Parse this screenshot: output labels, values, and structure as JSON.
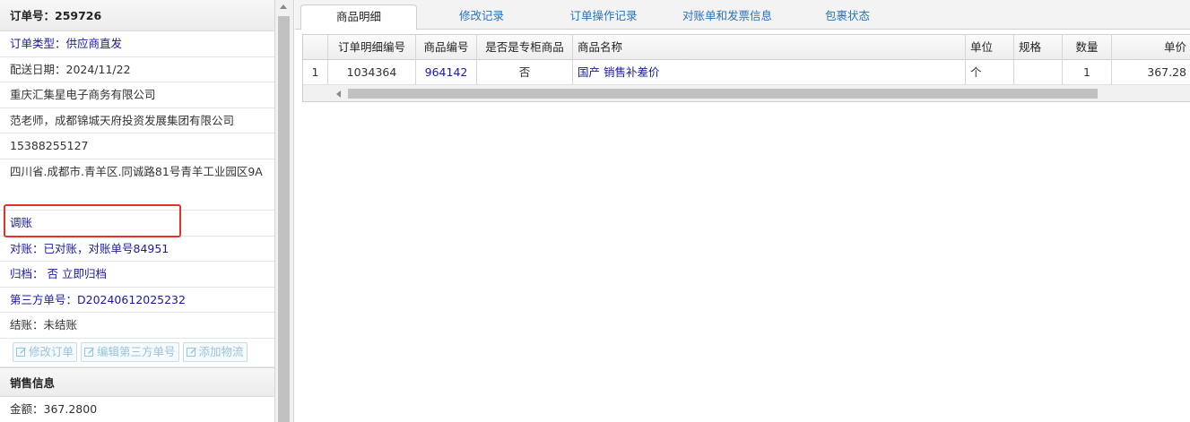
{
  "order": {
    "header": "订单号：259726",
    "type": "订单类型：供应商直发",
    "delivery_date": "配送日期：2024/11/22",
    "company": "重庆汇集星电子商务有限公司",
    "contact": "范老师，成都锦城天府投资发展集团有限公司",
    "phone": "15388255127",
    "address": "四川省.成都市.青羊区.同诚路81号青羊工业园区9A",
    "adjust": "调账",
    "reconcile": "对账：已对账，对账单号84951",
    "archive": "归档： 否 立即归档",
    "third_party": "第三方单号：D20240612025232",
    "settlement": "结账：未结账"
  },
  "actions": {
    "edit_order": "修改订单",
    "edit_third_party": "编辑第三方单号",
    "add_logistics": "添加物流"
  },
  "sales": {
    "title": "销售信息",
    "amount": "金额：367.2800"
  },
  "tabs": [
    {
      "label": "商品明细",
      "active": true
    },
    {
      "label": "修改记录",
      "active": false
    },
    {
      "label": "订单操作记录",
      "active": false
    },
    {
      "label": "对账单和发票信息",
      "active": false
    },
    {
      "label": "包裹状态",
      "active": false
    }
  ],
  "table": {
    "columns": [
      "",
      "订单明细编号",
      "商品编号",
      "是否是专柜商品",
      "商品名称",
      "单位",
      "规格",
      "数量",
      "单价"
    ],
    "rows": [
      {
        "idx": "1",
        "detail_no": "1034364",
        "product_no": "964142",
        "counter": "否",
        "name": "国产 销售补差价",
        "unit": "个",
        "spec": "",
        "qty": "1",
        "price": "367.28"
      }
    ]
  },
  "colors": {
    "link": "#1a1a9c",
    "tab_link": "#2a73b8",
    "highlight": "#e8302b"
  }
}
